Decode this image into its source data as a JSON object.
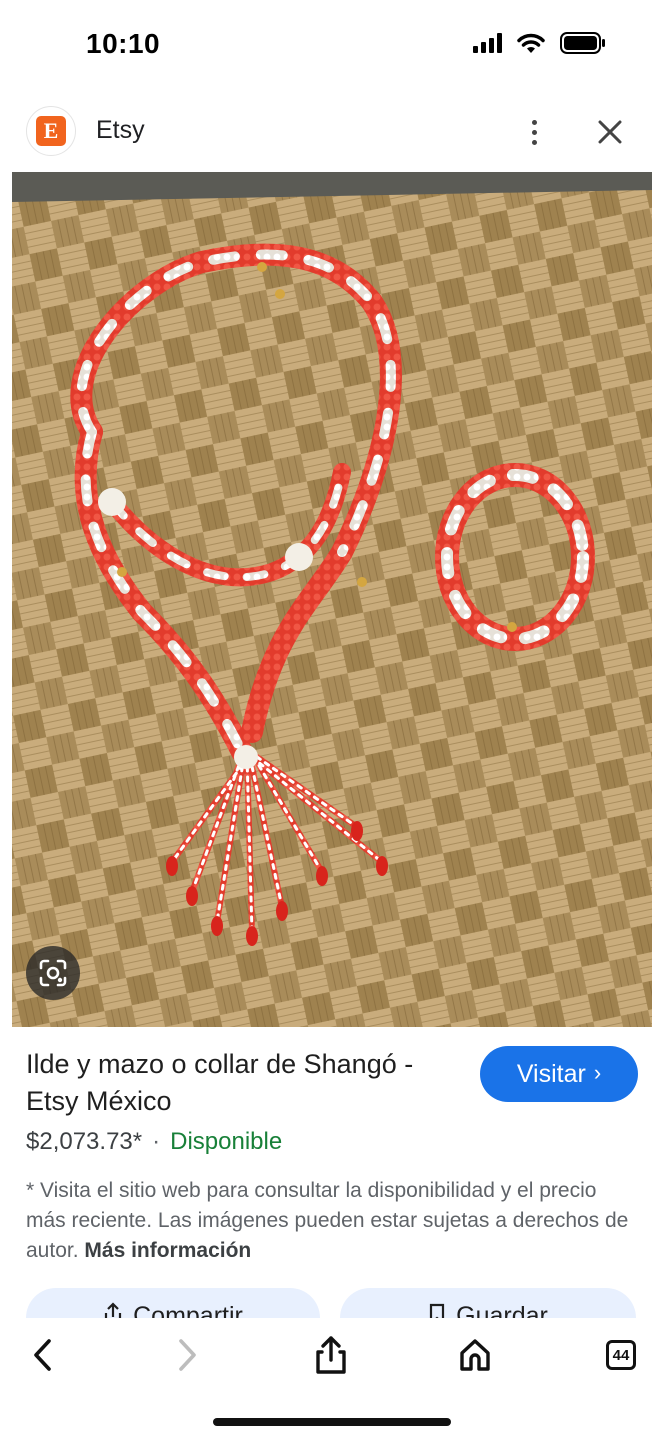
{
  "status": {
    "time": "10:10"
  },
  "header": {
    "site_logo_letter": "E",
    "site_name": "Etsy"
  },
  "product": {
    "title": "Ilde y mazo o collar de Shangó - Etsy México",
    "visit_label": "Visitar",
    "price": "$2,073.73*",
    "separator": "·",
    "availability": "Disponible",
    "disclaimer": "* Visita el sitio web para consultar la disponibilidad y el precio más reciente. Las imágenes pueden estar sujetas a derechos de autor.",
    "more_info": "Más información"
  },
  "actions": {
    "share_label": "Compartir",
    "save_label": "Guardar"
  },
  "toolbar": {
    "tabs_count": "44"
  },
  "colors": {
    "accent": "#1a73e8",
    "availability": "#188038",
    "brand": "#f1641e"
  },
  "icons": [
    "signal-icon",
    "wifi-icon",
    "battery-icon",
    "more-vert-icon",
    "close-icon",
    "lens-icon",
    "share-icon",
    "bookmark-icon",
    "back-icon",
    "forward-icon",
    "home-icon",
    "tabs-icon"
  ]
}
